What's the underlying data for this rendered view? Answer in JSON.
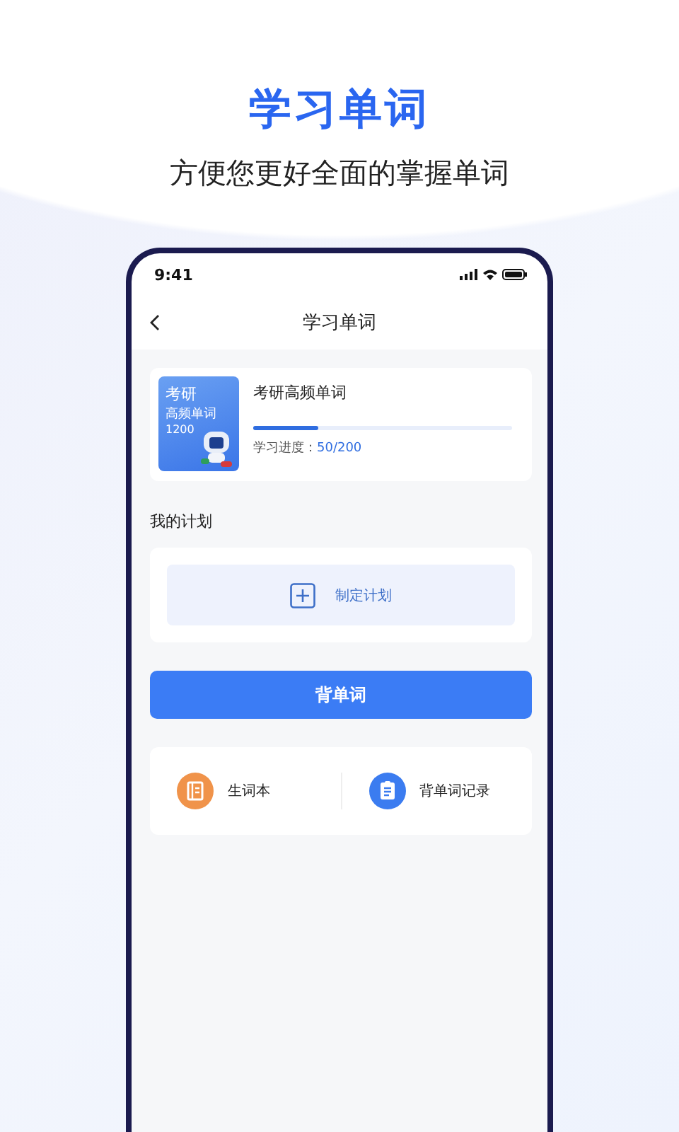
{
  "hero": {
    "title": "学习单词",
    "subtitle": "方便您更好全面的掌握单词"
  },
  "status_bar": {
    "time": "9:41"
  },
  "nav": {
    "title": "学习单词"
  },
  "book": {
    "cover_lines": [
      "考研",
      "高频单词",
      "1200"
    ],
    "title": "考研高频单词",
    "progress_label": "学习进度：",
    "progress_value": "50/200",
    "level": 0.25
  },
  "plan": {
    "heading": "我的计划",
    "action": "制定计划"
  },
  "primary_button": "背单词",
  "shortcuts": [
    {
      "kind": "notebook",
      "label": "生词本",
      "color": "#f0934a"
    },
    {
      "kind": "record",
      "label": "背单词记录",
      "color": "#3b7cf0"
    }
  ]
}
